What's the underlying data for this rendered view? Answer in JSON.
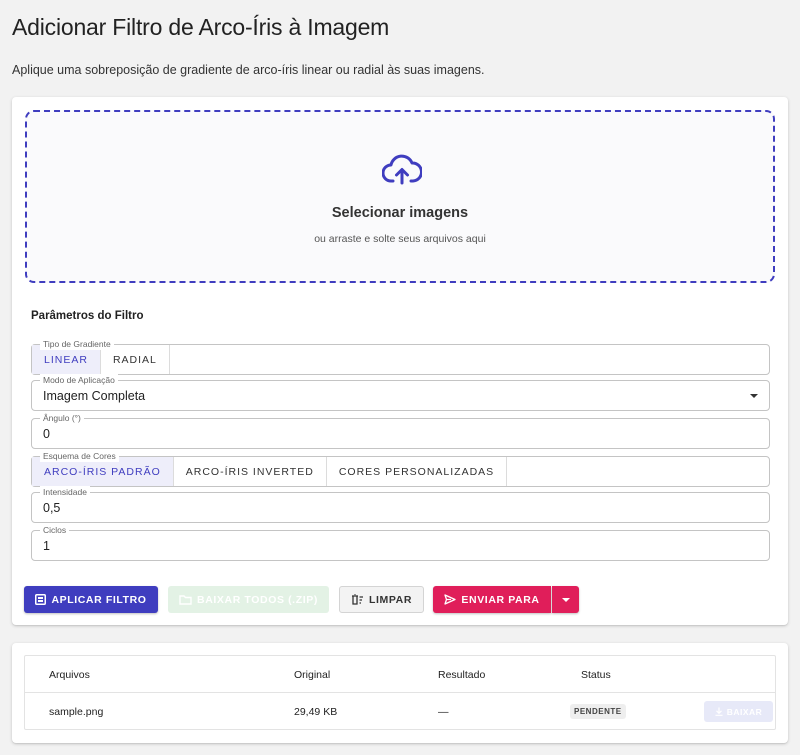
{
  "page": {
    "title": "Adicionar Filtro de Arco-Íris à Imagem",
    "subtitle": "Aplique uma sobreposição de gradiente de arco-íris linear ou radial às suas imagens."
  },
  "dropzone": {
    "icon": "cloud-upload-icon",
    "title": "Selecionar imagens",
    "hint": "ou arraste e solte seus arquivos aqui"
  },
  "params": {
    "title": "Parâmetros do Filtro",
    "gradient_type": {
      "label": "Tipo de Gradiente",
      "options": [
        "LINEAR",
        "RADIAL"
      ],
      "selected": "LINEAR"
    },
    "mode": {
      "label": "Modo de Aplicação",
      "value": "Imagem Completa"
    },
    "angle": {
      "label": "Ângulo (°)",
      "value": "0"
    },
    "scheme": {
      "label": "Esquema de Cores",
      "options": [
        "ARCO-ÍRIS PADRÃO",
        "ARCO-ÍRIS INVERTED",
        "CORES PERSONALIZADAS"
      ],
      "selected": "ARCO-ÍRIS PADRÃO"
    },
    "intensity": {
      "label": "Intensidade",
      "value": "0,5"
    },
    "cycles": {
      "label": "Ciclos",
      "value": "1"
    }
  },
  "actions": {
    "apply": "APLICAR FILTRO",
    "download_zip": "BAIXAR TODOS (.ZIP)",
    "clear": "LIMPAR",
    "send": "ENVIAR PARA"
  },
  "files": {
    "columns": [
      "Arquivos",
      "Original",
      "Resultado",
      "Status"
    ],
    "rows": [
      {
        "name": "sample.png",
        "original": "29,49 KB",
        "result": "—",
        "status": "PENDENTE",
        "download": "BAIXAR"
      }
    ]
  },
  "colors": {
    "primary": "#3f3dbf",
    "send": "#e01e5a",
    "zip_disabled": "#e3f2e5"
  }
}
